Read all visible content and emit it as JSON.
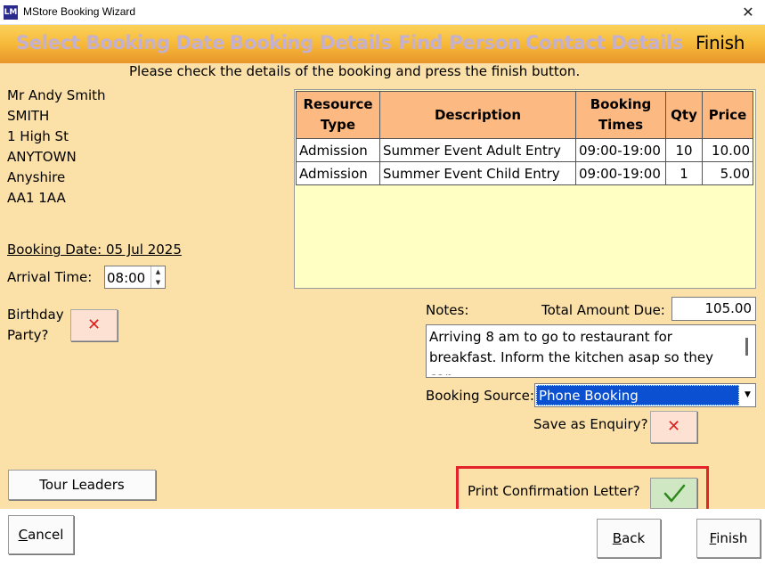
{
  "window": {
    "icon_text": "LM",
    "title": "MStore Booking Wizard",
    "close_glyph": "✕"
  },
  "steps": [
    {
      "label": "Select Booking Date"
    },
    {
      "label": "Booking Details"
    },
    {
      "label": "Find Person"
    },
    {
      "label": "Contact Details"
    },
    {
      "label": "Finish"
    }
  ],
  "instruction": "Please check the details of the booking and press the finish button.",
  "address": [
    "Mr Andy Smith",
    "SMITH",
    "1 High St",
    "ANYTOWN",
    "Anyshire",
    "AA1 1AA"
  ],
  "booking_date": "Booking Date: 05 Jul 2025",
  "arrival": {
    "label": "Arrival Time:",
    "value": "08:00"
  },
  "birthday": {
    "label_line1": "Birthday",
    "label_line2": "Party?",
    "glyph": "✕"
  },
  "table": {
    "headers": {
      "resource_line1": "Resource",
      "resource_line2": "Type",
      "description": "Description",
      "times_line1": "Booking",
      "times_line2": "Times",
      "qty": "Qty",
      "price": "Price"
    },
    "rows": [
      {
        "resource": "Admission",
        "description": "Summer Event Adult Entry",
        "times": "09:00-19:00",
        "qty": "10",
        "price": "10.00"
      },
      {
        "resource": "Admission",
        "description": "Summer Event Child Entry",
        "times": "09:00-19:00",
        "qty": "1",
        "price": "5.00"
      }
    ]
  },
  "notes": {
    "label": "Notes:",
    "text": "Arriving 8 am to go to restaurant for breakfast. Inform the kitchen asap so they can"
  },
  "total": {
    "label": "Total Amount Due:",
    "value": "105.00"
  },
  "booking_source": {
    "label": "Booking Source:",
    "value": "Phone Booking"
  },
  "enquiry": {
    "label": "Save as Enquiry?",
    "glyph": "✕"
  },
  "print": {
    "label": "Print Confirmation Letter?",
    "checked": true
  },
  "buttons": {
    "tour_leaders": "Tour Leaders",
    "cancel_first": "C",
    "cancel_rest": "ancel",
    "back_first": "B",
    "back_rest": "ack",
    "finish_first": "F",
    "finish_rest": "inish"
  },
  "colors": {
    "header_gradient_top": "#fbd25a",
    "header_gradient_bottom": "#e9952a",
    "panel_bg": "#fbe0a7",
    "grid_bg": "#ffffc4",
    "table_header_bg": "#fcb981",
    "highlight_border": "#e4222a",
    "selection_blue": "#0a50d0",
    "inactive_step": "#c4b0cf"
  }
}
